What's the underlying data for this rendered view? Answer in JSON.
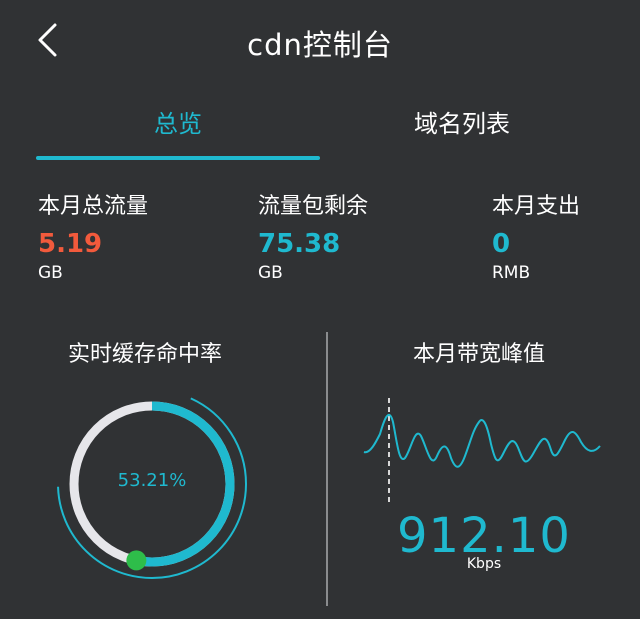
{
  "header": {
    "title": "cdn控制台",
    "back_icon": "chevron-left-icon"
  },
  "tabs": [
    {
      "label": "总览",
      "active": true
    },
    {
      "label": "域名列表",
      "active": false
    }
  ],
  "stats": [
    {
      "label": "本月总流量",
      "value": "5.19",
      "unit": "GB",
      "color": "#f25a3c"
    },
    {
      "label": "流量包剩余",
      "value": "75.38",
      "unit": "GB",
      "color": "#1fb9cf"
    },
    {
      "label": "本月支出",
      "value": "0",
      "unit": "RMB",
      "color": "#1fb9cf"
    }
  ],
  "cache": {
    "title": "实时缓存命中率",
    "value_label": "53.21%",
    "fraction": 0.5321
  },
  "bandwidth": {
    "title": "本月带宽峰值",
    "value": "912.10",
    "unit": "Kbps"
  },
  "colors": {
    "accent": "#1fb9cf",
    "alert": "#f25a3c",
    "indicator_dot": "#2ebd4a",
    "background": "#303234"
  }
}
